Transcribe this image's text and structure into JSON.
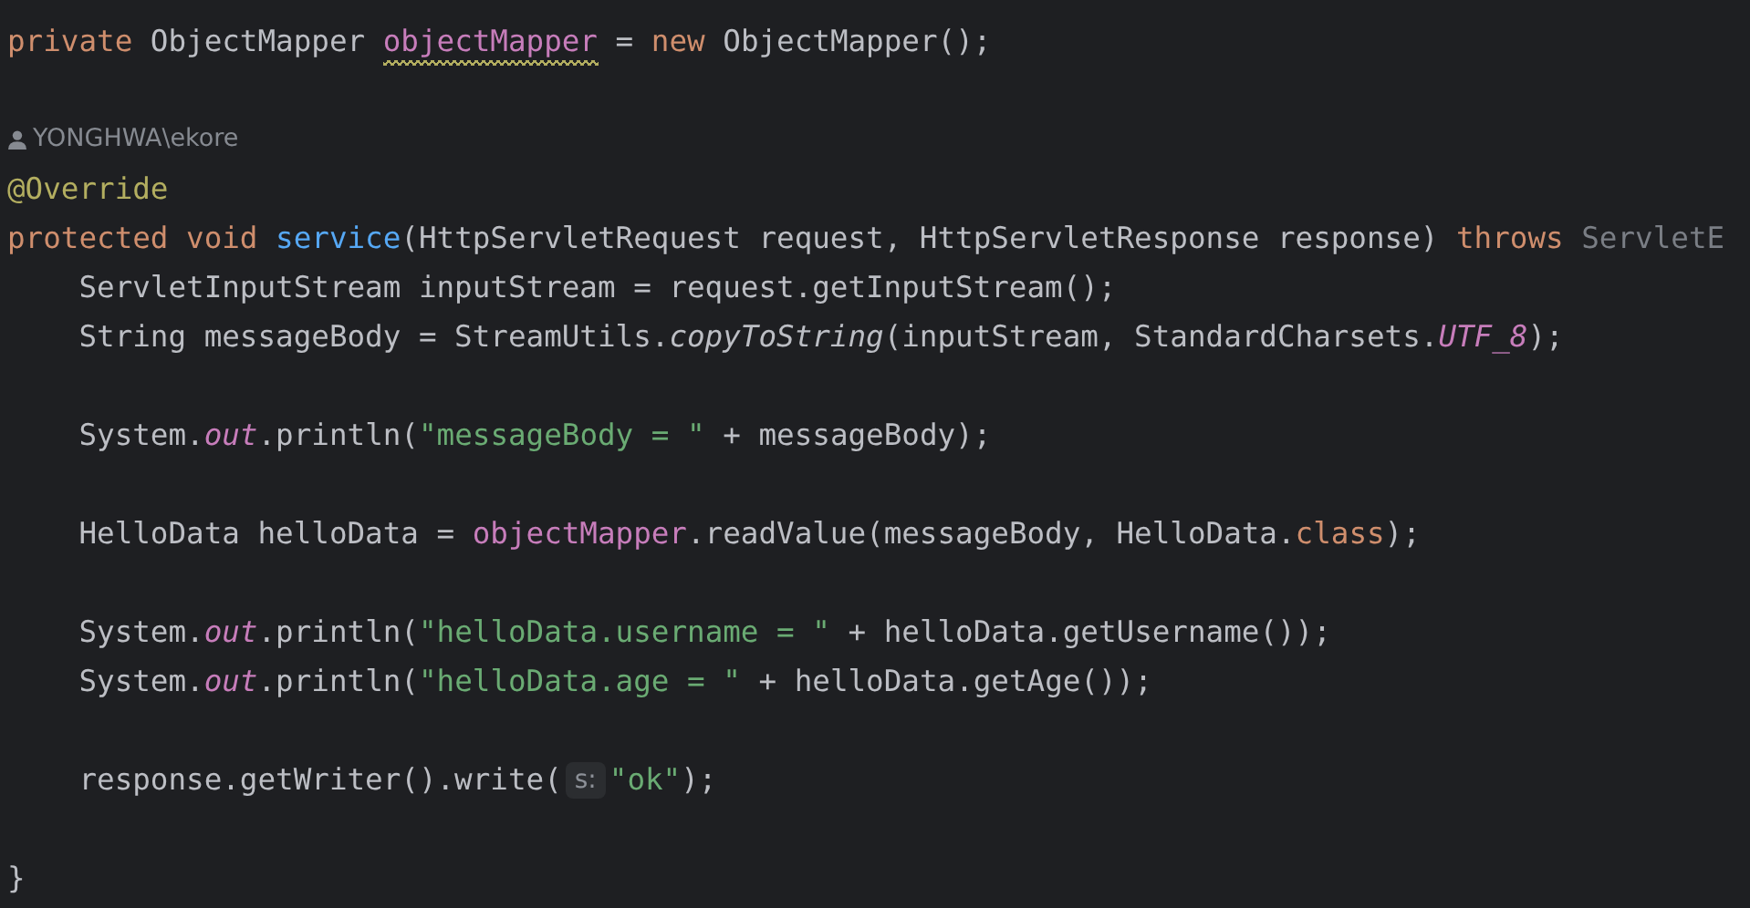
{
  "editor": {
    "lines": [
      {
        "kind": "code",
        "tokens": [
          {
            "text": "private ",
            "kind": "keyword"
          },
          {
            "text": "ObjectMapper ",
            "kind": "plain"
          },
          {
            "text": "objectMapper",
            "kind": "field",
            "warning": true
          },
          {
            "text": " = ",
            "kind": "plain"
          },
          {
            "text": "new ",
            "kind": "keyword"
          },
          {
            "text": "ObjectMapper();",
            "kind": "plain"
          }
        ]
      },
      {
        "kind": "blank"
      },
      {
        "kind": "author",
        "text": "YONGHWA\\ekore"
      },
      {
        "kind": "code",
        "tokens": [
          {
            "text": "@Override",
            "kind": "annotation"
          }
        ]
      },
      {
        "kind": "code",
        "tokens": [
          {
            "text": "protected void ",
            "kind": "keyword"
          },
          {
            "text": "service",
            "kind": "method"
          },
          {
            "text": "(HttpServletRequest request, HttpServletResponse response) ",
            "kind": "plain"
          },
          {
            "text": "throws ",
            "kind": "keyword"
          },
          {
            "text": "ServletE",
            "kind": "dim"
          }
        ]
      },
      {
        "kind": "code",
        "tokens": [
          {
            "text": "    ServletInputStream inputStream = request.getInputStream();",
            "kind": "plain"
          }
        ]
      },
      {
        "kind": "code",
        "tokens": [
          {
            "text": "    String messageBody = StreamUtils.",
            "kind": "plain"
          },
          {
            "text": "copyToString",
            "kind": "static_method"
          },
          {
            "text": "(inputStream, StandardCharsets.",
            "kind": "plain"
          },
          {
            "text": "UTF_8",
            "kind": "static_field"
          },
          {
            "text": ");",
            "kind": "plain"
          }
        ]
      },
      {
        "kind": "blank"
      },
      {
        "kind": "code",
        "tokens": [
          {
            "text": "    System.",
            "kind": "plain"
          },
          {
            "text": "out",
            "kind": "static_field"
          },
          {
            "text": ".println(",
            "kind": "plain"
          },
          {
            "text": "\"messageBody = \"",
            "kind": "string"
          },
          {
            "text": " + messageBody);",
            "kind": "plain"
          }
        ]
      },
      {
        "kind": "blank"
      },
      {
        "kind": "code",
        "tokens": [
          {
            "text": "    HelloData helloData = ",
            "kind": "plain"
          },
          {
            "text": "objectMapper",
            "kind": "field"
          },
          {
            "text": ".readValue(messageBody, HelloData.",
            "kind": "plain"
          },
          {
            "text": "class",
            "kind": "keyword"
          },
          {
            "text": ");",
            "kind": "plain"
          }
        ]
      },
      {
        "kind": "blank"
      },
      {
        "kind": "code",
        "tokens": [
          {
            "text": "    System.",
            "kind": "plain"
          },
          {
            "text": "out",
            "kind": "static_field"
          },
          {
            "text": ".println(",
            "kind": "plain"
          },
          {
            "text": "\"helloData.username = \"",
            "kind": "string"
          },
          {
            "text": " + helloData.getUsername());",
            "kind": "plain"
          }
        ]
      },
      {
        "kind": "code",
        "tokens": [
          {
            "text": "    System.",
            "kind": "plain"
          },
          {
            "text": "out",
            "kind": "static_field"
          },
          {
            "text": ".println(",
            "kind": "plain"
          },
          {
            "text": "\"helloData.age = \"",
            "kind": "string"
          },
          {
            "text": " + helloData.getAge());",
            "kind": "plain"
          }
        ]
      },
      {
        "kind": "blank"
      },
      {
        "kind": "code",
        "tokens": [
          {
            "text": "    response.getWriter().write(",
            "kind": "plain"
          },
          {
            "text": "s:",
            "kind": "hint"
          },
          {
            "text": "\"ok\"",
            "kind": "string"
          },
          {
            "text": ");",
            "kind": "plain"
          }
        ]
      },
      {
        "kind": "blank"
      },
      {
        "kind": "code",
        "tokens": [
          {
            "text": "}",
            "kind": "plain"
          }
        ]
      }
    ]
  }
}
